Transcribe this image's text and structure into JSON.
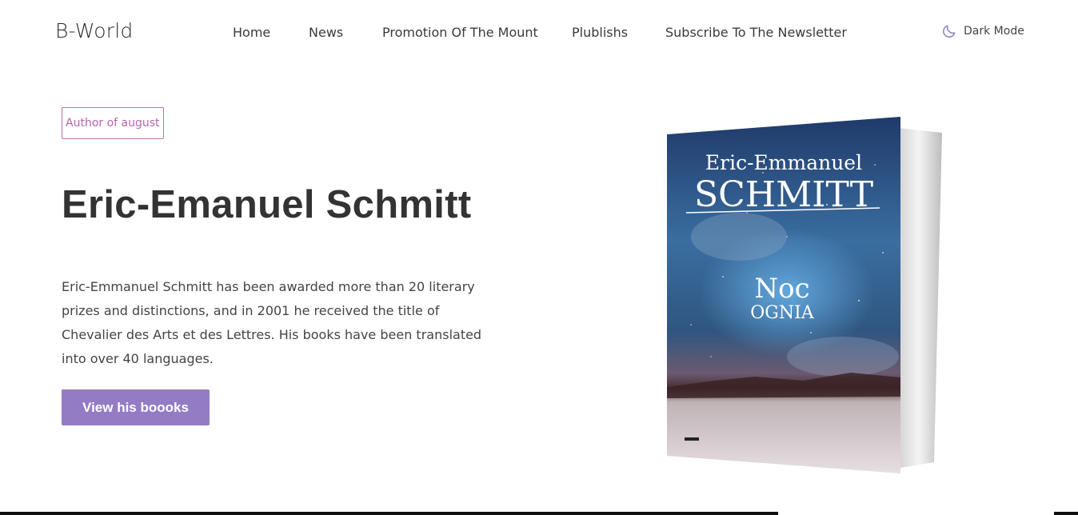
{
  "header": {
    "logo": "B-World",
    "nav": [
      "Home",
      "News",
      "Promotion Of The Mount",
      "Plublishs",
      "Subscribe To The Newsletter"
    ],
    "dark_mode_label": "Dark Mode",
    "dark_mode_icon": "moon-icon"
  },
  "hero": {
    "badge": "Author of august",
    "title": "Eric-Emanuel Schmitt",
    "description": "Eric-Emmanuel Schmitt has been awarded more than 20 literary prizes and distinctions, and in 2001 he received the title of Chevalier des Arts et des Lettres. His books have been translated into over 40 languages.",
    "cta_label": "View his boooks"
  },
  "book": {
    "author_line1": "Eric-Emmanuel",
    "author_line2": "SCHMITT",
    "title_line1": "Noc",
    "title_line2": "OGNIA"
  },
  "colors": {
    "accent": "#937cc4",
    "badge": "#b666aa",
    "moon": "#8a7dc4"
  }
}
